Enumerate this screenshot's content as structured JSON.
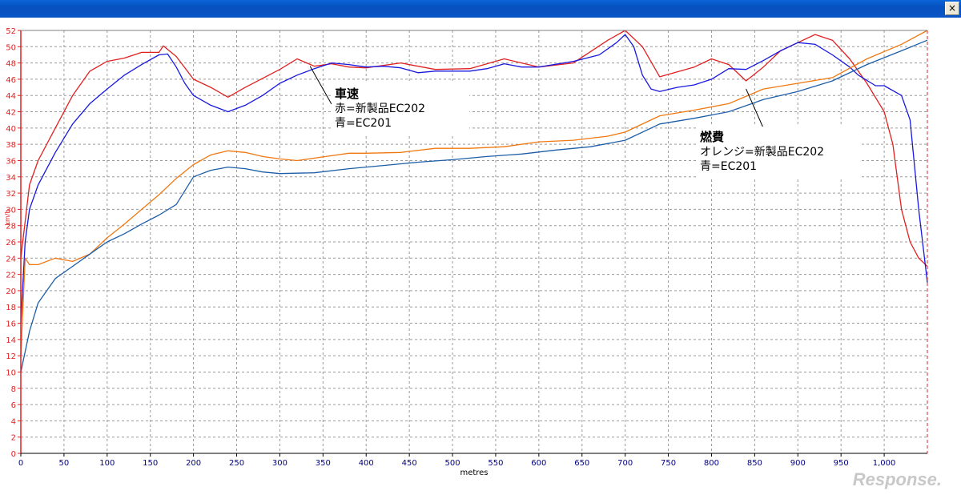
{
  "window": {
    "close_label": "×"
  },
  "watermark": "Response.",
  "chart_data": {
    "type": "line",
    "xlabel": "metres",
    "ylabel": "km/h",
    "xlim": [
      0,
      1050
    ],
    "ylim": [
      0,
      52
    ],
    "xticks": [
      "0",
      "50",
      "100",
      "150",
      "200",
      "250",
      "300",
      "350",
      "400",
      "450",
      "500",
      "550",
      "600",
      "650",
      "700",
      "750",
      "800",
      "850",
      "900",
      "950",
      "1,000"
    ],
    "yticks": [
      "0",
      "2",
      "4",
      "6",
      "8",
      "10",
      "12",
      "14",
      "16",
      "18",
      "20",
      "22",
      "24",
      "26",
      "28",
      "30",
      "32",
      "34",
      "36",
      "38",
      "40",
      "42",
      "44",
      "46",
      "48",
      "50",
      "52"
    ],
    "grid": true,
    "series": [
      {
        "color": "#e02020",
        "x": [
          0,
          10,
          20,
          40,
          60,
          80,
          100,
          120,
          140,
          160,
          165,
          180,
          200,
          220,
          240,
          260,
          300,
          320,
          340,
          360,
          380,
          400,
          440,
          480,
          520,
          560,
          600,
          640,
          680,
          700,
          720,
          740,
          780,
          800,
          820,
          840,
          860,
          880,
          900,
          920,
          940,
          960,
          980,
          1000,
          1010,
          1020,
          1030,
          1040,
          1050
        ],
        "values": [
          24,
          33,
          36,
          40,
          44,
          47,
          48.2,
          48.6,
          49.3,
          49.3,
          50.1,
          48.8,
          46,
          45,
          43.8,
          45,
          47.2,
          48.5,
          47.6,
          47.9,
          47.5,
          47.4,
          48,
          47.2,
          47.3,
          48.5,
          47.5,
          48,
          50.8,
          52,
          50,
          46.3,
          47.5,
          48.5,
          47.8,
          45.8,
          47.5,
          49.5,
          50.5,
          51.5,
          50.8,
          48.5,
          45.5,
          42,
          38,
          30,
          26,
          24,
          23
        ]
      },
      {
        "color": "#1818e0",
        "x": [
          0,
          5,
          10,
          20,
          40,
          60,
          80,
          100,
          120,
          140,
          160,
          170,
          180,
          190,
          200,
          220,
          240,
          260,
          280,
          300,
          320,
          340,
          360,
          380,
          400,
          420,
          440,
          460,
          480,
          500,
          520,
          540,
          560,
          580,
          600,
          640,
          670,
          690,
          700,
          710,
          720,
          730,
          740,
          760,
          780,
          800,
          820,
          840,
          860,
          880,
          900,
          920,
          940,
          960,
          970,
          990,
          1000,
          1020,
          1030,
          1040,
          1050
        ],
        "values": [
          16,
          26,
          30,
          33,
          37,
          40.5,
          43,
          44.8,
          46.5,
          47.8,
          49,
          49.1,
          47.5,
          45.5,
          44,
          42.8,
          42,
          42.8,
          44,
          45.5,
          46.5,
          47.3,
          48,
          47.8,
          47.5,
          47.6,
          47.4,
          46.8,
          47,
          47,
          47,
          47.3,
          47.9,
          47.5,
          47.5,
          48.2,
          49,
          50.5,
          51.5,
          50,
          46.5,
          44.8,
          44.5,
          45,
          45.3,
          46,
          47.3,
          47.2,
          48.3,
          49.5,
          50.5,
          50.3,
          49,
          47.5,
          46.5,
          45.2,
          45.2,
          44,
          41,
          30,
          21
        ]
      },
      {
        "color": "#f07810",
        "x": [
          0,
          5,
          10,
          20,
          40,
          60,
          80,
          100,
          120,
          140,
          160,
          180,
          200,
          220,
          240,
          260,
          280,
          300,
          320,
          340,
          360,
          380,
          400,
          440,
          480,
          520,
          560,
          600,
          640,
          680,
          700,
          740,
          780,
          820,
          860,
          900,
          940,
          980,
          1020,
          1050
        ],
        "values": [
          12,
          24,
          23.2,
          23.2,
          24,
          23.6,
          24.5,
          26.5,
          28.2,
          30,
          31.8,
          33.8,
          35.5,
          36.7,
          37.2,
          37,
          36.5,
          36.2,
          36,
          36.3,
          36.6,
          36.9,
          36.9,
          37,
          37.5,
          37.5,
          37.7,
          38.3,
          38.5,
          39,
          39.5,
          41.5,
          42.2,
          43,
          44.8,
          45.5,
          46.2,
          48.5,
          50.3,
          52
        ]
      },
      {
        "color": "#1d5ea8",
        "x": [
          0,
          5,
          10,
          20,
          40,
          60,
          80,
          100,
          120,
          140,
          160,
          180,
          200,
          220,
          240,
          260,
          280,
          300,
          340,
          380,
          420,
          460,
          500,
          540,
          580,
          620,
          660,
          700,
          740,
          780,
          820,
          860,
          900,
          940,
          980,
          1020,
          1050
        ],
        "values": [
          10,
          12.5,
          15,
          18.5,
          21.5,
          23,
          24.5,
          26,
          27,
          28.2,
          29.3,
          30.6,
          34,
          34.8,
          35.2,
          35,
          34.6,
          34.4,
          34.5,
          35,
          35.4,
          35.8,
          36.1,
          36.5,
          36.8,
          37.3,
          37.7,
          38.5,
          40.5,
          41.2,
          42,
          43.5,
          44.5,
          45.8,
          47.8,
          49.5,
          50.8
        ]
      }
    ],
    "annotations": [
      {
        "title": "車速",
        "lines": [
          "赤=新製品EC202",
          "青=EC201"
        ]
      },
      {
        "title": "燃費",
        "lines": [
          "オレンジ=新製品EC202",
          "青=EC201"
        ]
      }
    ]
  }
}
